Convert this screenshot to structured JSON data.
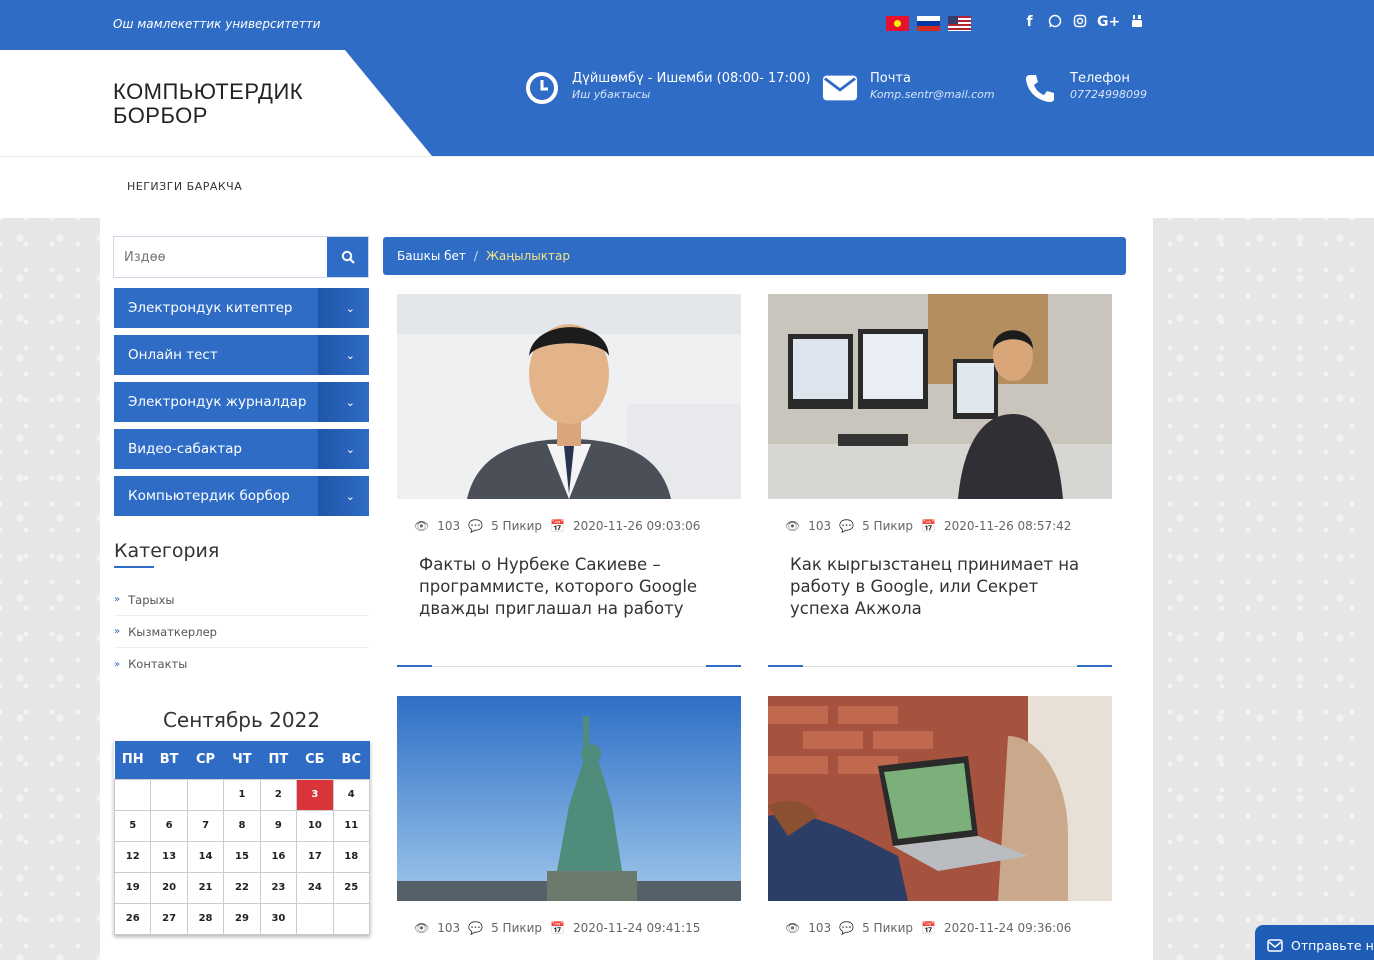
{
  "topbar": {
    "university": "Ош мамлекеттик университетти",
    "flags": [
      "kg-flag",
      "ru-flag",
      "us-flag"
    ],
    "socials": [
      "facebook-icon",
      "whatsapp-icon",
      "instagram-icon",
      "google-plus-icon",
      "youtube-icon"
    ]
  },
  "header": {
    "logo_line1": "КОМПЬЮТЕРДИК",
    "logo_line2": "БОРБОР",
    "hours_title": "Дүйшөмбү - Ишемби (08:00- 17:00)",
    "hours_sub": "Иш убактысы",
    "mail_title": "Почта",
    "mail_sub": "Komp.sentr@mail.com",
    "phone_title": "Телефон",
    "phone_sub": "07724998099"
  },
  "nav": {
    "home": "НЕГИЗГИ БАРАКЧА"
  },
  "sidebar": {
    "search_placeholder": "Издөө",
    "menu": [
      "Электрондук китептер",
      "Онлайн тест",
      "Электрондук журналдар",
      "Видео-сабактар",
      "Компьютердик борбор"
    ],
    "category_title": "Категория",
    "categories": [
      "Тарыхы",
      "Кызматкерлер",
      "Контакты"
    ]
  },
  "calendar": {
    "title": "Сентябрь 2022",
    "days": [
      "ПН",
      "ВТ",
      "СР",
      "ЧТ",
      "ПТ",
      "СБ",
      "ВС"
    ],
    "today": 3,
    "weeks": [
      [
        "",
        "",
        "",
        "1",
        "2",
        "3",
        "4"
      ],
      [
        "5",
        "6",
        "7",
        "8",
        "9",
        "10",
        "11"
      ],
      [
        "12",
        "13",
        "14",
        "15",
        "16",
        "17",
        "18"
      ],
      [
        "19",
        "20",
        "21",
        "22",
        "23",
        "24",
        "25"
      ],
      [
        "26",
        "27",
        "28",
        "29",
        "30",
        "",
        ""
      ]
    ]
  },
  "breadcrumb": {
    "home": "Башкы бет",
    "current": "Жаңылыктар"
  },
  "cards": [
    {
      "views": "103",
      "comments": "5 Пикир",
      "date": "2020-11-26 09:03:06",
      "title": "Факты о Нурбеке Сакиеве – программисте, которого Google дважды приглашал на работу"
    },
    {
      "views": "103",
      "comments": "5 Пикир",
      "date": "2020-11-26 08:57:42",
      "title": "Как кыргызстанец принимает на работу в Google, или Секрет успеха Акжола"
    },
    {
      "views": "103",
      "comments": "5 Пикир",
      "date": "2020-11-24 09:41:15",
      "title": ""
    },
    {
      "views": "103",
      "comments": "5 Пикир",
      "date": "2020-11-24 09:36:06",
      "title": ""
    }
  ],
  "chat": {
    "label": "Отправьте на"
  },
  "colors": {
    "primary": "#2f6cc5",
    "accent": "#f4e28a",
    "today": "#d9343a"
  }
}
